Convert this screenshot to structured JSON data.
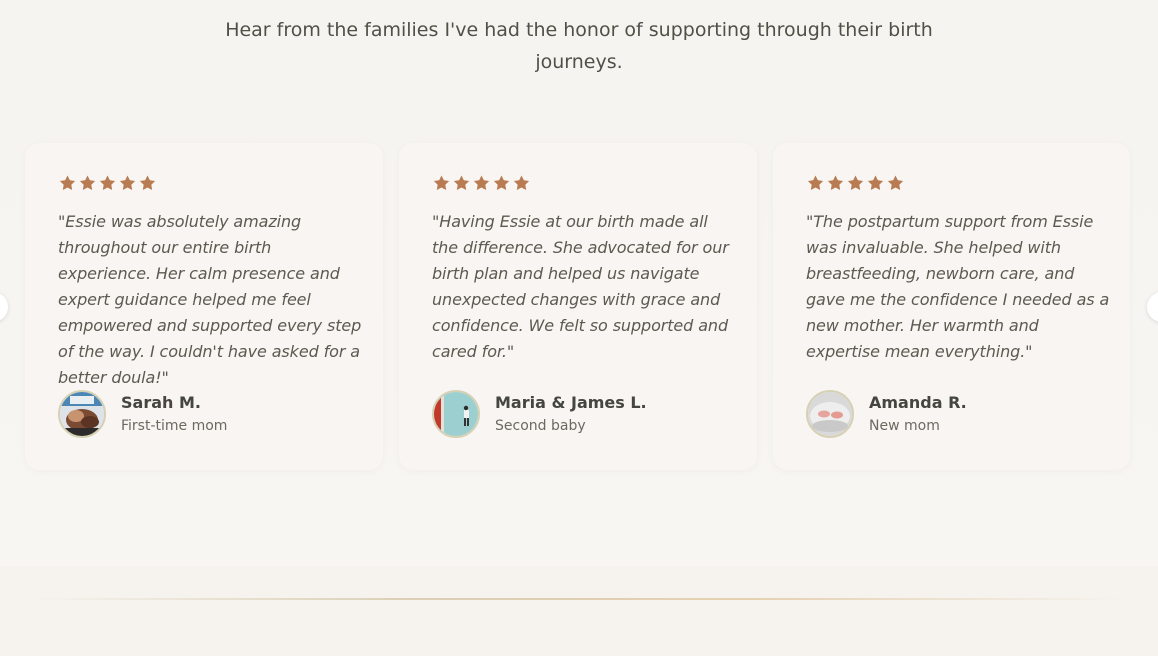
{
  "intro": {
    "text": "Hear from the families I've had the honor of supporting through their birth journeys."
  },
  "colors": {
    "star": "#b87b52",
    "background": "#f7f5f1",
    "card": "#f8f5f2"
  },
  "testimonials": [
    {
      "rating": 5,
      "quote": "\"Essie was absolutely amazing throughout our entire birth experience. Her calm presence and expert guidance helped me feel empowered and supported every step of the way. I couldn't have asked for a better doula!\"",
      "name": "Sarah M.",
      "role": "First-time mom"
    },
    {
      "rating": 5,
      "quote": "\"Having Essie at our birth made all the difference. She advocated for our birth plan and helped us navigate unexpected changes with grace and confidence. We felt so supported and cared for.\"",
      "name": "Maria & James L.",
      "role": "Second baby"
    },
    {
      "rating": 5,
      "quote": "\"The postpartum support from Essie was invaluable. She helped with breastfeeding, newborn care, and gave me the confidence I needed as a new mother. Her warmth and expertise mean everything.\"",
      "name": "Amanda R.",
      "role": "New mom"
    }
  ],
  "icons": {
    "star": "star-icon",
    "prev": "chevron-left-icon",
    "next": "chevron-right-icon"
  }
}
